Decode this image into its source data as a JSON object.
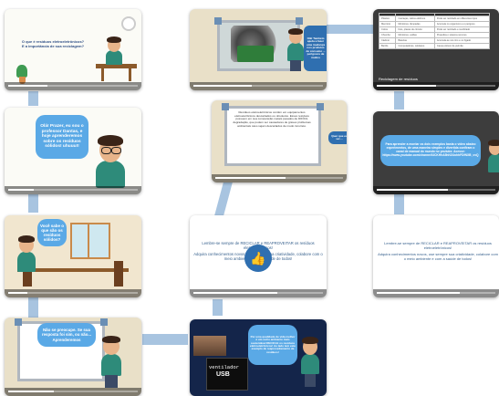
{
  "slides": {
    "s1": {
      "question": "O que é resíduos eletroeletrônicos? E a importância de sua reciclagem?"
    },
    "s2": {
      "bubble": "Olá! Também ajuda a fazer uma mudança nos produtos de consumo ... perigosos de muitos"
    },
    "s3": {
      "headers": [
        "",
        "",
        ""
      ],
      "rows": [
        [
          "Plástico",
          "Carcaças, cabos elétricos",
          "Pode ser reciclado em diferentes tipos"
        ],
        [
          "Mercúrio",
          "Monitores, lâmpadas",
          "Acumula no organismo e é perigoso"
        ],
        [
          "Cobre",
          "Fios, placas de circuito",
          "Pode ser reciclado e reutilizado"
        ],
        [
          "Chumbo",
          "Monitores, soldas",
          "Prejudica o sistema nervoso"
        ],
        [
          "Cádmio",
          "Baterias",
          "Acumula-se nos rins e no fígado"
        ],
        [
          "Berílio",
          "Computadores, celulares",
          "Causa câncer de pulmão"
        ]
      ],
      "caption": "Reciclagem de resíduos"
    },
    "s4": {
      "bubble": "Olá! Prazer, eu sou o professor Dantas, e hoje aprenderemos sobre os resíduos sólidos! uhuuu!!"
    },
    "s5": {
      "board": "Resíduos eletroeletrônicos contêm em equipamentos eletroeletrônicos descartados ou obsoletos. Esses resíduos possuem em sua composição metais pesados de DIFÍCIL degradação, que podem ser causadores de graves problemas ambientais caso sejam descartados de modo incorreto.",
      "bubble": "Quer que eu sei ..."
    },
    "s6": {
      "bubble": "Para aprender a montar os dois exemplos basta o vídeo abaixo experimentos, de uma maneira simples e divertida confiram o canal de manual do mundo no youtube. Acesse: https://www.youtube.com/channel/UCKHhA5hN2UohhFDfNXB_cvQ"
    },
    "s7": {
      "bubble": "Você sabe o que são os resíduos sólidos?"
    },
    "s8": {
      "text1": "Lembre-se sempre de RECICLAR e REAPROVEITAR os resíduos eletroeletrônicos!",
      "text2": "Adquira conhecimentos novos, use sempre sua criatividade, colabore com o meio ambiente e com a saúde de todos!",
      "thumb": "👍"
    },
    "s9": {
      "text1": "Lembre-se sempre de RECICLAR e REAPROVEITAR os resíduos eletroeletrônicos!",
      "text2": "Adquira conhecimentos novos, use sempre sua criatividade, colabore com o meio ambiente e com a saúde de todos!"
    },
    "s10": {
      "board": "Não se preocupe. Se sua resposta foi sim, ou não... Aprenderemos"
    },
    "s11": {
      "bubble": "Por uma qualidade de vida melhor é um outro ambiente mais sustentável RECICLE os resíduos eletroeletrônicos! Ao lado tem este exemplo de reaproveitamento de resíduos!",
      "product_line1": "ventilador",
      "product_line2": "USB"
    }
  },
  "colors": {
    "accent": "#5aa9e6",
    "connector": "#a8c4e0"
  },
  "player": {
    "progress": [
      0.3,
      0.45,
      0.5,
      0.2,
      0.55,
      0.6,
      0.15,
      0.65,
      0.7,
      0.35,
      0.8
    ]
  }
}
